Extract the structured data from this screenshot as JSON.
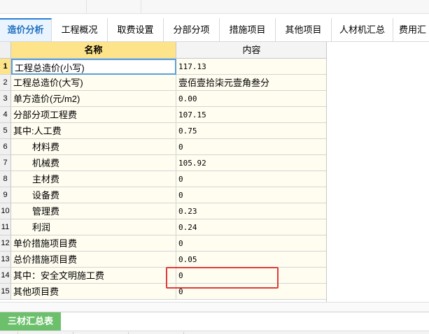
{
  "tabs": [
    {
      "label": "造价分析",
      "active": true
    },
    {
      "label": "工程概况",
      "active": false
    },
    {
      "label": "取费设置",
      "active": false
    },
    {
      "label": "分部分项",
      "active": false
    },
    {
      "label": "措施项目",
      "active": false
    },
    {
      "label": "其他项目",
      "active": false
    },
    {
      "label": "人材机汇总",
      "active": false
    },
    {
      "label": "费用汇",
      "active": false
    }
  ],
  "table": {
    "headers": {
      "name": "名称",
      "content": "内容"
    },
    "rows": [
      {
        "num": "1",
        "name": "工程总造价(小写)",
        "value": "117.13"
      },
      {
        "num": "2",
        "name": "工程总造价(大写)",
        "value": "壹佰壹拾柒元壹角叁分"
      },
      {
        "num": "3",
        "name": "单方造价(元/m2)",
        "value": "0.00"
      },
      {
        "num": "4",
        "name": "分部分项工程费",
        "value": "107.15"
      },
      {
        "num": "5",
        "name": "其中:人工费",
        "value": "0.75"
      },
      {
        "num": "6",
        "name": "材料费",
        "value": "0"
      },
      {
        "num": "7",
        "name": "机械费",
        "value": "105.92"
      },
      {
        "num": "8",
        "name": "主材费",
        "value": "0"
      },
      {
        "num": "9",
        "name": "设备费",
        "value": "0"
      },
      {
        "num": "10",
        "name": "管理费",
        "value": "0.23"
      },
      {
        "num": "11",
        "name": "利润",
        "value": "0.24"
      },
      {
        "num": "12",
        "name": "单价措施项目费",
        "value": "0"
      },
      {
        "num": "13",
        "name": "总价措施项目费",
        "value": "0.05"
      },
      {
        "num": "14",
        "name": "其中：安全文明施工费",
        "value": "0"
      },
      {
        "num": "15",
        "name": "其他项目费",
        "value": "0"
      }
    ]
  },
  "bottom": {
    "tab_label": "三材汇总表"
  },
  "colors": {
    "active_tab": "#1f6fbf",
    "header_yellow": "#fde48a",
    "bottom_tab_green": "#6cc06c",
    "highlight_red": "#e23a3a"
  }
}
